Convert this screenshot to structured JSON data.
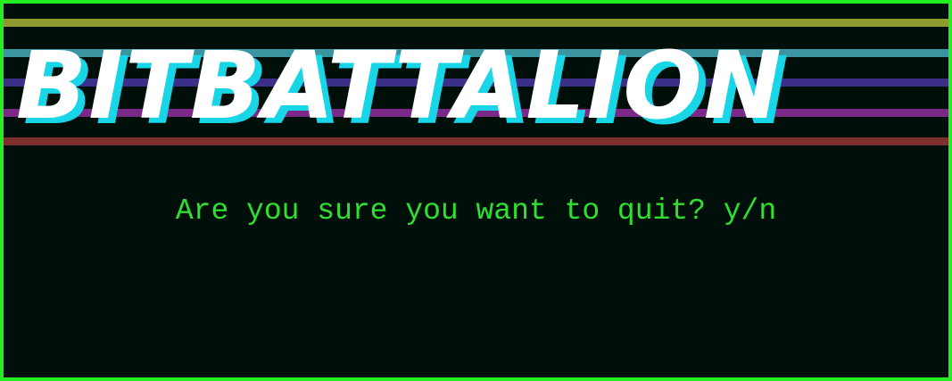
{
  "game": {
    "title": "BITBATTALION",
    "quit_prompt": "Are you sure you want to quit? y/n"
  },
  "colors": {
    "border": "#22ee22",
    "background": "#010f0b",
    "prompt_text": "#2fe02f",
    "logo_fill": "#ffffff",
    "logo_shadow": "#19d6e6",
    "stripes": [
      "#8f9a2f",
      "#3a95a0",
      "#3b2f88",
      "#7a2a86",
      "#7d2f2f"
    ]
  }
}
